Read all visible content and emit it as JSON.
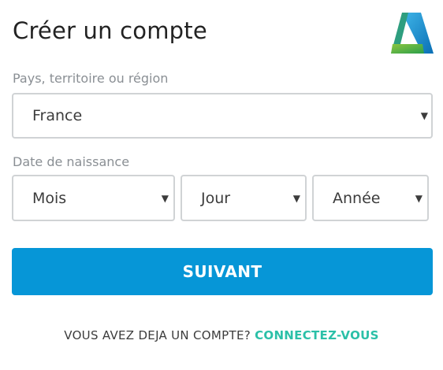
{
  "header": {
    "title": "Créer un compte",
    "logo_icon": "autodesk-logo-icon"
  },
  "form": {
    "country": {
      "label": "Pays, territoire ou région",
      "value": "France"
    },
    "birthdate": {
      "label": "Date de naissance",
      "month": "Mois",
      "day": "Jour",
      "year": "Année"
    },
    "next_button": "SUIVANT"
  },
  "footer": {
    "prompt": "VOUS AVEZ DEJA UN COMPTE?",
    "link": "CONNECTEZ-VOUS"
  },
  "colors": {
    "primary_button": "#0696d7",
    "link": "#2bc0a8",
    "border": "#d0d3d5",
    "label": "#8a8f94"
  }
}
